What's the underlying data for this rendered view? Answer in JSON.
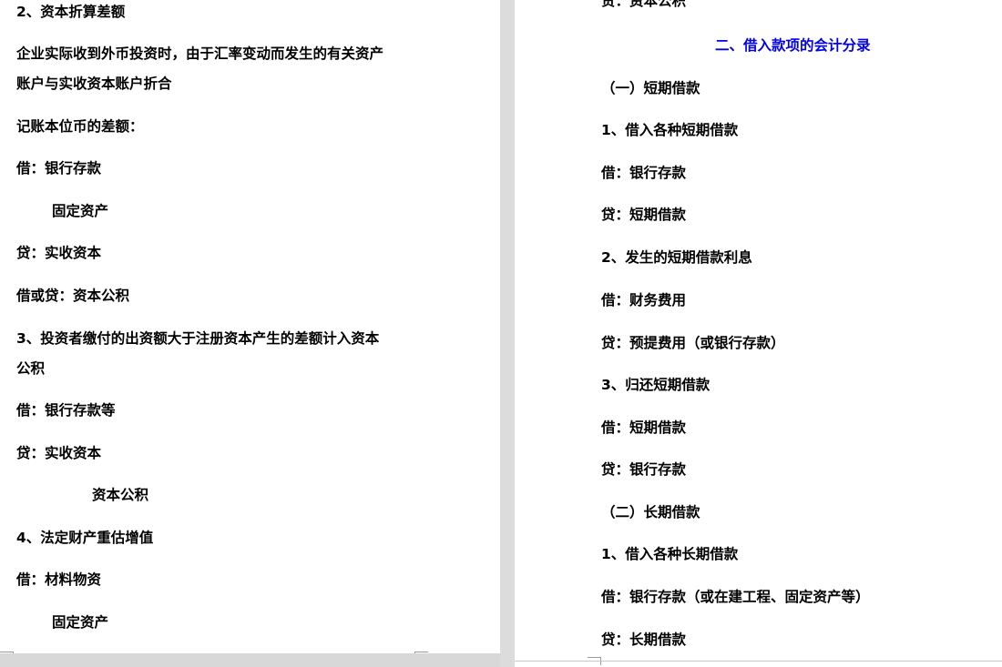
{
  "left_page": {
    "lines": [
      "2、资本折算差额",
      "企业实际收到外币投资时，由于汇率变动而发生的有关资产",
      "账户与实收资本账户折合",
      "记账本位币的差额：",
      "借：银行存款",
      "固定资产",
      "贷：实收资本",
      "借或贷：资本公积",
      "3、投资者缴付的出资额大于注册资本产生的差额计入资本",
      "公积",
      "借：银行存款等",
      "贷：实收资本",
      "资本公积",
      "4、法定财产重估增值",
      "借：材料物资",
      "固定资产"
    ]
  },
  "right_page": {
    "top_partial": "贷：资本公积",
    "section_heading": "二、借入款项的会计分录",
    "lines": [
      "（一）短期借款",
      "1、借入各种短期借款",
      "借：银行存款",
      "贷：短期借款",
      "2、发生的短期借款利息",
      "借：财务费用",
      "贷：预提费用（或银行存款）",
      "3、归还短期借款",
      "借：短期借款",
      "贷：银行存款",
      "（二）长期借款",
      "1、借入各种长期借款",
      "借：银行存款（或在建工程、固定资产等）",
      "贷：长期借款"
    ]
  },
  "colors": {
    "heading": "#0000ee",
    "text": "#000000",
    "gap": "#dcdcdc"
  }
}
